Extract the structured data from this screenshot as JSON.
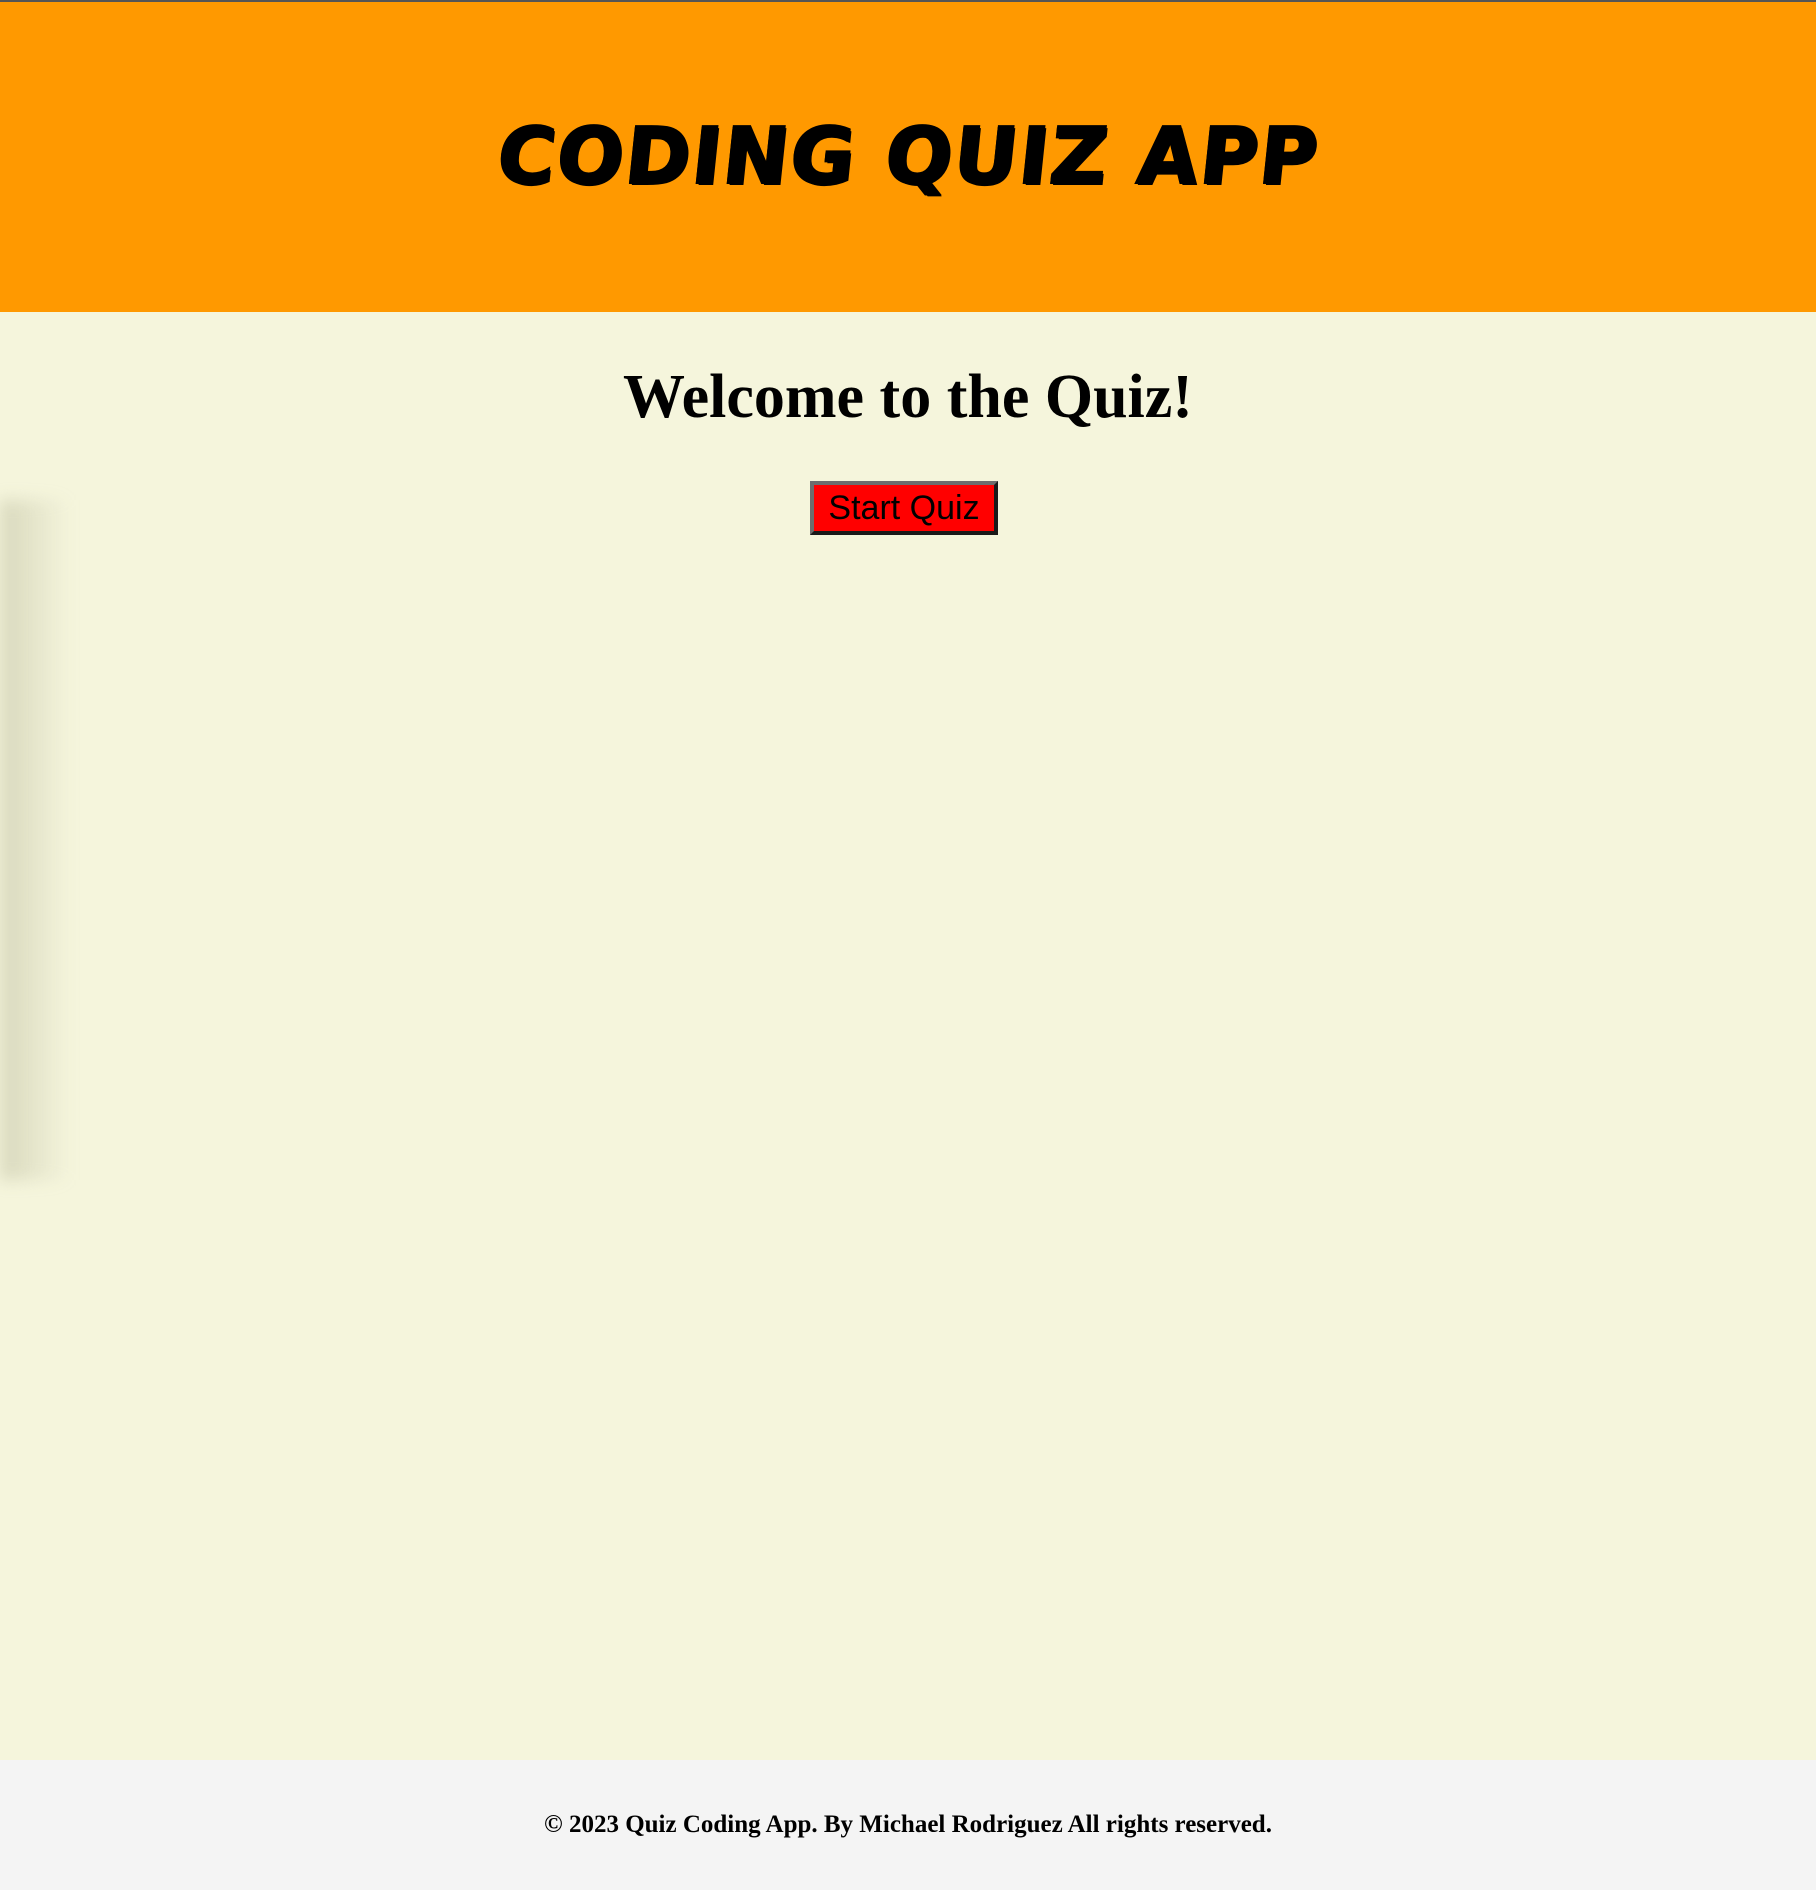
{
  "header": {
    "title": "Coding Quiz App"
  },
  "main": {
    "heading": "Welcome to the Quiz!",
    "start_button_label": "Start Quiz"
  },
  "footer": {
    "text": "© 2023 Quiz Coding App. By Michael Rodriguez All rights reserved."
  },
  "colors": {
    "header_bg": "#ff9900",
    "page_bg": "#f5f5dc",
    "button_bg": "#ff0000",
    "footer_bg": "#f4f4f4"
  }
}
